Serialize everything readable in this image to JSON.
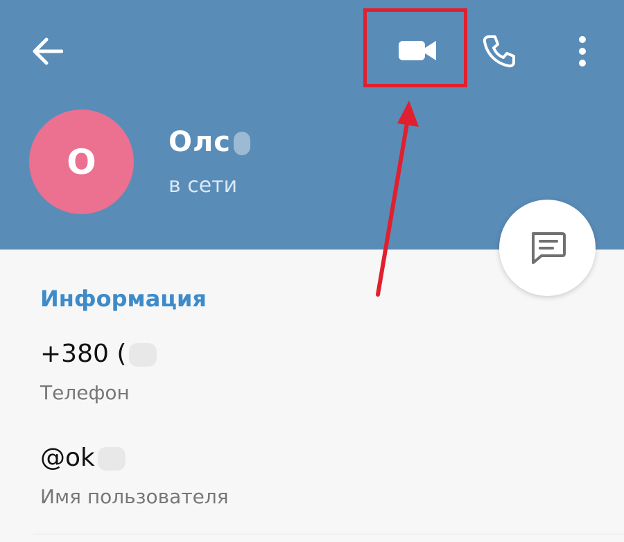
{
  "header": {
    "back_icon": "arrow-left-icon",
    "video_call_icon": "video-camera-icon",
    "call_icon": "phone-icon",
    "menu_icon": "more-vertical-icon",
    "color": "#5a8cb8"
  },
  "contact": {
    "avatar_letter": "O",
    "name": "Олс",
    "status": "в сети",
    "avatar_color": "#ec7090"
  },
  "fab": {
    "icon": "message-icon"
  },
  "info": {
    "section_title": "Информация",
    "phone_value": "+380 (",
    "phone_label": "Телефон",
    "username_value": "@ok",
    "username_label": "Имя пользователя"
  },
  "annotation": {
    "highlight_color": "#e0202e"
  }
}
